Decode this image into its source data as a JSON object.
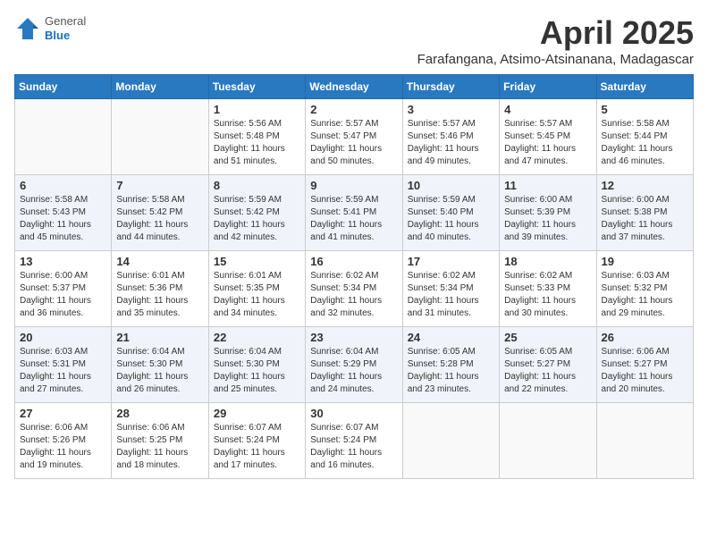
{
  "header": {
    "logo": {
      "general": "General",
      "blue": "Blue"
    },
    "month": "April 2025",
    "location": "Farafangana, Atsimo-Atsinanana, Madagascar"
  },
  "weekdays": [
    "Sunday",
    "Monday",
    "Tuesday",
    "Wednesday",
    "Thursday",
    "Friday",
    "Saturday"
  ],
  "weeks": [
    [
      {
        "day": "",
        "sunrise": "",
        "sunset": "",
        "daylight": ""
      },
      {
        "day": "",
        "sunrise": "",
        "sunset": "",
        "daylight": ""
      },
      {
        "day": "1",
        "sunrise": "Sunrise: 5:56 AM",
        "sunset": "Sunset: 5:48 PM",
        "daylight": "Daylight: 11 hours and 51 minutes."
      },
      {
        "day": "2",
        "sunrise": "Sunrise: 5:57 AM",
        "sunset": "Sunset: 5:47 PM",
        "daylight": "Daylight: 11 hours and 50 minutes."
      },
      {
        "day": "3",
        "sunrise": "Sunrise: 5:57 AM",
        "sunset": "Sunset: 5:46 PM",
        "daylight": "Daylight: 11 hours and 49 minutes."
      },
      {
        "day": "4",
        "sunrise": "Sunrise: 5:57 AM",
        "sunset": "Sunset: 5:45 PM",
        "daylight": "Daylight: 11 hours and 47 minutes."
      },
      {
        "day": "5",
        "sunrise": "Sunrise: 5:58 AM",
        "sunset": "Sunset: 5:44 PM",
        "daylight": "Daylight: 11 hours and 46 minutes."
      }
    ],
    [
      {
        "day": "6",
        "sunrise": "Sunrise: 5:58 AM",
        "sunset": "Sunset: 5:43 PM",
        "daylight": "Daylight: 11 hours and 45 minutes."
      },
      {
        "day": "7",
        "sunrise": "Sunrise: 5:58 AM",
        "sunset": "Sunset: 5:42 PM",
        "daylight": "Daylight: 11 hours and 44 minutes."
      },
      {
        "day": "8",
        "sunrise": "Sunrise: 5:59 AM",
        "sunset": "Sunset: 5:42 PM",
        "daylight": "Daylight: 11 hours and 42 minutes."
      },
      {
        "day": "9",
        "sunrise": "Sunrise: 5:59 AM",
        "sunset": "Sunset: 5:41 PM",
        "daylight": "Daylight: 11 hours and 41 minutes."
      },
      {
        "day": "10",
        "sunrise": "Sunrise: 5:59 AM",
        "sunset": "Sunset: 5:40 PM",
        "daylight": "Daylight: 11 hours and 40 minutes."
      },
      {
        "day": "11",
        "sunrise": "Sunrise: 6:00 AM",
        "sunset": "Sunset: 5:39 PM",
        "daylight": "Daylight: 11 hours and 39 minutes."
      },
      {
        "day": "12",
        "sunrise": "Sunrise: 6:00 AM",
        "sunset": "Sunset: 5:38 PM",
        "daylight": "Daylight: 11 hours and 37 minutes."
      }
    ],
    [
      {
        "day": "13",
        "sunrise": "Sunrise: 6:00 AM",
        "sunset": "Sunset: 5:37 PM",
        "daylight": "Daylight: 11 hours and 36 minutes."
      },
      {
        "day": "14",
        "sunrise": "Sunrise: 6:01 AM",
        "sunset": "Sunset: 5:36 PM",
        "daylight": "Daylight: 11 hours and 35 minutes."
      },
      {
        "day": "15",
        "sunrise": "Sunrise: 6:01 AM",
        "sunset": "Sunset: 5:35 PM",
        "daylight": "Daylight: 11 hours and 34 minutes."
      },
      {
        "day": "16",
        "sunrise": "Sunrise: 6:02 AM",
        "sunset": "Sunset: 5:34 PM",
        "daylight": "Daylight: 11 hours and 32 minutes."
      },
      {
        "day": "17",
        "sunrise": "Sunrise: 6:02 AM",
        "sunset": "Sunset: 5:34 PM",
        "daylight": "Daylight: 11 hours and 31 minutes."
      },
      {
        "day": "18",
        "sunrise": "Sunrise: 6:02 AM",
        "sunset": "Sunset: 5:33 PM",
        "daylight": "Daylight: 11 hours and 30 minutes."
      },
      {
        "day": "19",
        "sunrise": "Sunrise: 6:03 AM",
        "sunset": "Sunset: 5:32 PM",
        "daylight": "Daylight: 11 hours and 29 minutes."
      }
    ],
    [
      {
        "day": "20",
        "sunrise": "Sunrise: 6:03 AM",
        "sunset": "Sunset: 5:31 PM",
        "daylight": "Daylight: 11 hours and 27 minutes."
      },
      {
        "day": "21",
        "sunrise": "Sunrise: 6:04 AM",
        "sunset": "Sunset: 5:30 PM",
        "daylight": "Daylight: 11 hours and 26 minutes."
      },
      {
        "day": "22",
        "sunrise": "Sunrise: 6:04 AM",
        "sunset": "Sunset: 5:30 PM",
        "daylight": "Daylight: 11 hours and 25 minutes."
      },
      {
        "day": "23",
        "sunrise": "Sunrise: 6:04 AM",
        "sunset": "Sunset: 5:29 PM",
        "daylight": "Daylight: 11 hours and 24 minutes."
      },
      {
        "day": "24",
        "sunrise": "Sunrise: 6:05 AM",
        "sunset": "Sunset: 5:28 PM",
        "daylight": "Daylight: 11 hours and 23 minutes."
      },
      {
        "day": "25",
        "sunrise": "Sunrise: 6:05 AM",
        "sunset": "Sunset: 5:27 PM",
        "daylight": "Daylight: 11 hours and 22 minutes."
      },
      {
        "day": "26",
        "sunrise": "Sunrise: 6:06 AM",
        "sunset": "Sunset: 5:27 PM",
        "daylight": "Daylight: 11 hours and 20 minutes."
      }
    ],
    [
      {
        "day": "27",
        "sunrise": "Sunrise: 6:06 AM",
        "sunset": "Sunset: 5:26 PM",
        "daylight": "Daylight: 11 hours and 19 minutes."
      },
      {
        "day": "28",
        "sunrise": "Sunrise: 6:06 AM",
        "sunset": "Sunset: 5:25 PM",
        "daylight": "Daylight: 11 hours and 18 minutes."
      },
      {
        "day": "29",
        "sunrise": "Sunrise: 6:07 AM",
        "sunset": "Sunset: 5:24 PM",
        "daylight": "Daylight: 11 hours and 17 minutes."
      },
      {
        "day": "30",
        "sunrise": "Sunrise: 6:07 AM",
        "sunset": "Sunset: 5:24 PM",
        "daylight": "Daylight: 11 hours and 16 minutes."
      },
      {
        "day": "",
        "sunrise": "",
        "sunset": "",
        "daylight": ""
      },
      {
        "day": "",
        "sunrise": "",
        "sunset": "",
        "daylight": ""
      },
      {
        "day": "",
        "sunrise": "",
        "sunset": "",
        "daylight": ""
      }
    ]
  ]
}
